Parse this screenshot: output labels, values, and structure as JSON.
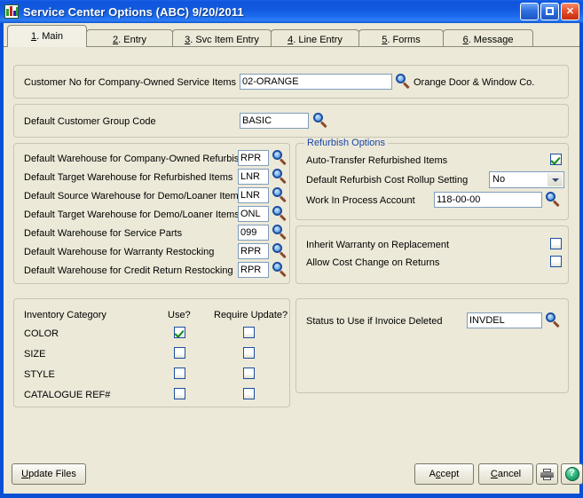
{
  "window": {
    "title": "Service Center Options (ABC) 9/20/2011",
    "app_icon": "chart-bars-icon",
    "buttons": {
      "minimize": "minimize-button",
      "maximize": "maximize-button",
      "close": "close-button"
    }
  },
  "tabs": [
    {
      "accel": "1",
      "label": ". Main",
      "active": true
    },
    {
      "accel": "2",
      "label": ". Entry",
      "active": false
    },
    {
      "accel": "3",
      "label": ". Svc Item Entry",
      "active": false
    },
    {
      "accel": "4",
      "label": ". Line Entry",
      "active": false
    },
    {
      "accel": "5",
      "label": ". Forms",
      "active": false
    },
    {
      "accel": "6",
      "label": ". Message",
      "active": false
    }
  ],
  "customer_panel": {
    "label": "Customer No for Company-Owned Service Items",
    "value": "02-ORANGE",
    "lookup": "lookup-icon",
    "description": "Orange Door & Window Co."
  },
  "group_panel": {
    "label": "Default Customer Group Code",
    "value": "BASIC",
    "lookup": "lookup-icon"
  },
  "warehouse_panel": {
    "rows": [
      {
        "label": "Default Warehouse for Company-Owned Refurbish",
        "value": "RPR"
      },
      {
        "label": "Default Target Warehouse for Refurbished Items",
        "value": "LNR"
      },
      {
        "label": "Default Source Warehouse for Demo/Loaner Items",
        "value": "LNR"
      },
      {
        "label": "Default Target Warehouse for Demo/Loaner Items",
        "value": "ONL"
      },
      {
        "label": "Default Warehouse for Service Parts",
        "value": "099"
      },
      {
        "label": "Default Warehouse for Warranty Restocking",
        "value": "RPR"
      },
      {
        "label": "Default Warehouse for Credit Return Restocking",
        "value": "RPR"
      }
    ]
  },
  "refurbish_panel": {
    "legend": "Refurbish Options",
    "legend_color": "#1845a8",
    "auto_transfer": {
      "label": "Auto-Transfer Refurbished Items",
      "checked": true
    },
    "cost_rollup": {
      "label": "Default Refurbish Cost Rollup Setting",
      "value": "No"
    },
    "wip_account": {
      "label": "Work In Process Account",
      "value": "118-00-00",
      "lookup": "lookup-icon"
    }
  },
  "warranty_panel": {
    "rows": [
      {
        "label": "Inherit Warranty on Replacement",
        "checked": false
      },
      {
        "label": "Allow Cost Change on Returns",
        "checked": false
      }
    ]
  },
  "inventory_panel": {
    "headers": [
      "Inventory Category",
      "Use?",
      "Require Update?"
    ],
    "rows": [
      {
        "label": "COLOR",
        "use": true,
        "require_update": false
      },
      {
        "label": "SIZE",
        "use": false,
        "require_update": false
      },
      {
        "label": "STYLE",
        "use": false,
        "require_update": false
      },
      {
        "label": "CATALOGUE REF#",
        "use": false,
        "require_update": false
      }
    ]
  },
  "status_panel": {
    "label": "Status to Use if Invoice Deleted",
    "value": "INVDEL",
    "lookup": "lookup-icon"
  },
  "footer": {
    "update_files": {
      "accel": "U",
      "rest": "pdate Files"
    },
    "accept": {
      "pre": "A",
      "accel": "c",
      "rest": "cept"
    },
    "cancel": {
      "pre": "",
      "accel": "C",
      "rest": "ancel"
    },
    "print": "printer-icon",
    "help": "help-icon"
  },
  "colors": {
    "title_bar": "#1159df",
    "frame": "#0a4fd4",
    "face": "#ece9d8",
    "panel_border": "#c8c5b4",
    "input_border": "#7f9db9",
    "legend": "#1845a8",
    "check": "#0f8a17"
  }
}
